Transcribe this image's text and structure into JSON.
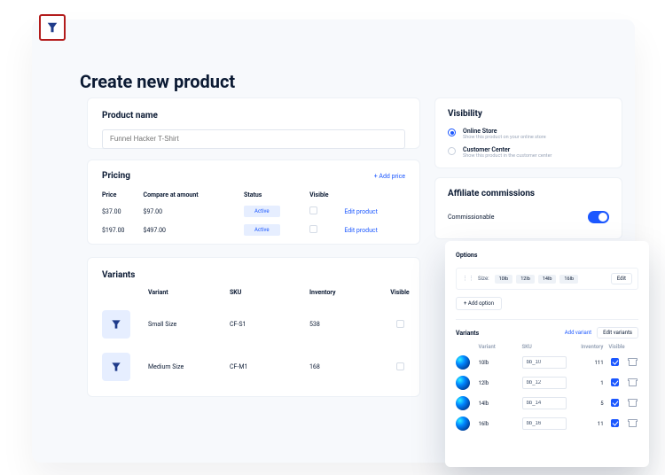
{
  "page": {
    "title": "Create new product"
  },
  "product_name": {
    "label": "Product name",
    "placeholder": "Funnel Hacker T-Shirt"
  },
  "pricing": {
    "title": "Pricing",
    "add_price": "+ Add price",
    "headers": {
      "price": "Price",
      "compare": "Compare at amount",
      "status": "Status",
      "visible": "Visible"
    },
    "rows": [
      {
        "price": "$37.00",
        "compare": "$97.00",
        "status": "Active",
        "edit": "Edit product"
      },
      {
        "price": "$197.00",
        "compare": "$497.00",
        "status": "Active",
        "edit": "Edit product"
      }
    ]
  },
  "variants": {
    "title": "Variants",
    "headers": {
      "variant": "Variant",
      "sku": "SKU",
      "inventory": "Inventory",
      "visible": "Visible"
    },
    "rows": [
      {
        "variant": "Small Size",
        "sku": "CF-S1",
        "inventory": "538"
      },
      {
        "variant": "Medium Size",
        "sku": "CF-M1",
        "inventory": "168"
      }
    ]
  },
  "visibility": {
    "title": "Visibility",
    "opts": [
      {
        "label": "Online Store",
        "desc": "Show this product on your online store",
        "selected": true
      },
      {
        "label": "Customer Center",
        "desc": "Show this product in the customer center",
        "selected": false
      }
    ]
  },
  "affiliate": {
    "title": "Affiliate commissions",
    "row_label": "Commissionable"
  },
  "float": {
    "options_title": "Options",
    "option_key": "Size:",
    "chips": [
      "10lb",
      "12lb",
      "14lb",
      "16lb"
    ],
    "edit_btn": "Edit",
    "add_option": "+ Add option",
    "variants_title": "Variants",
    "add_variant": "Add variant",
    "edit_variants": "Edit variants",
    "headers": {
      "variant": "Variant",
      "sku": "SKU",
      "inventory": "Inventory",
      "visible": "Visible"
    },
    "rows": [
      {
        "variant": "10lb",
        "sku": "bb_10",
        "inventory": "111"
      },
      {
        "variant": "12lb",
        "sku": "bb_12",
        "inventory": "1"
      },
      {
        "variant": "14lb",
        "sku": "bb_14",
        "inventory": "5"
      },
      {
        "variant": "16lb",
        "sku": "bb_16",
        "inventory": "11"
      }
    ]
  }
}
